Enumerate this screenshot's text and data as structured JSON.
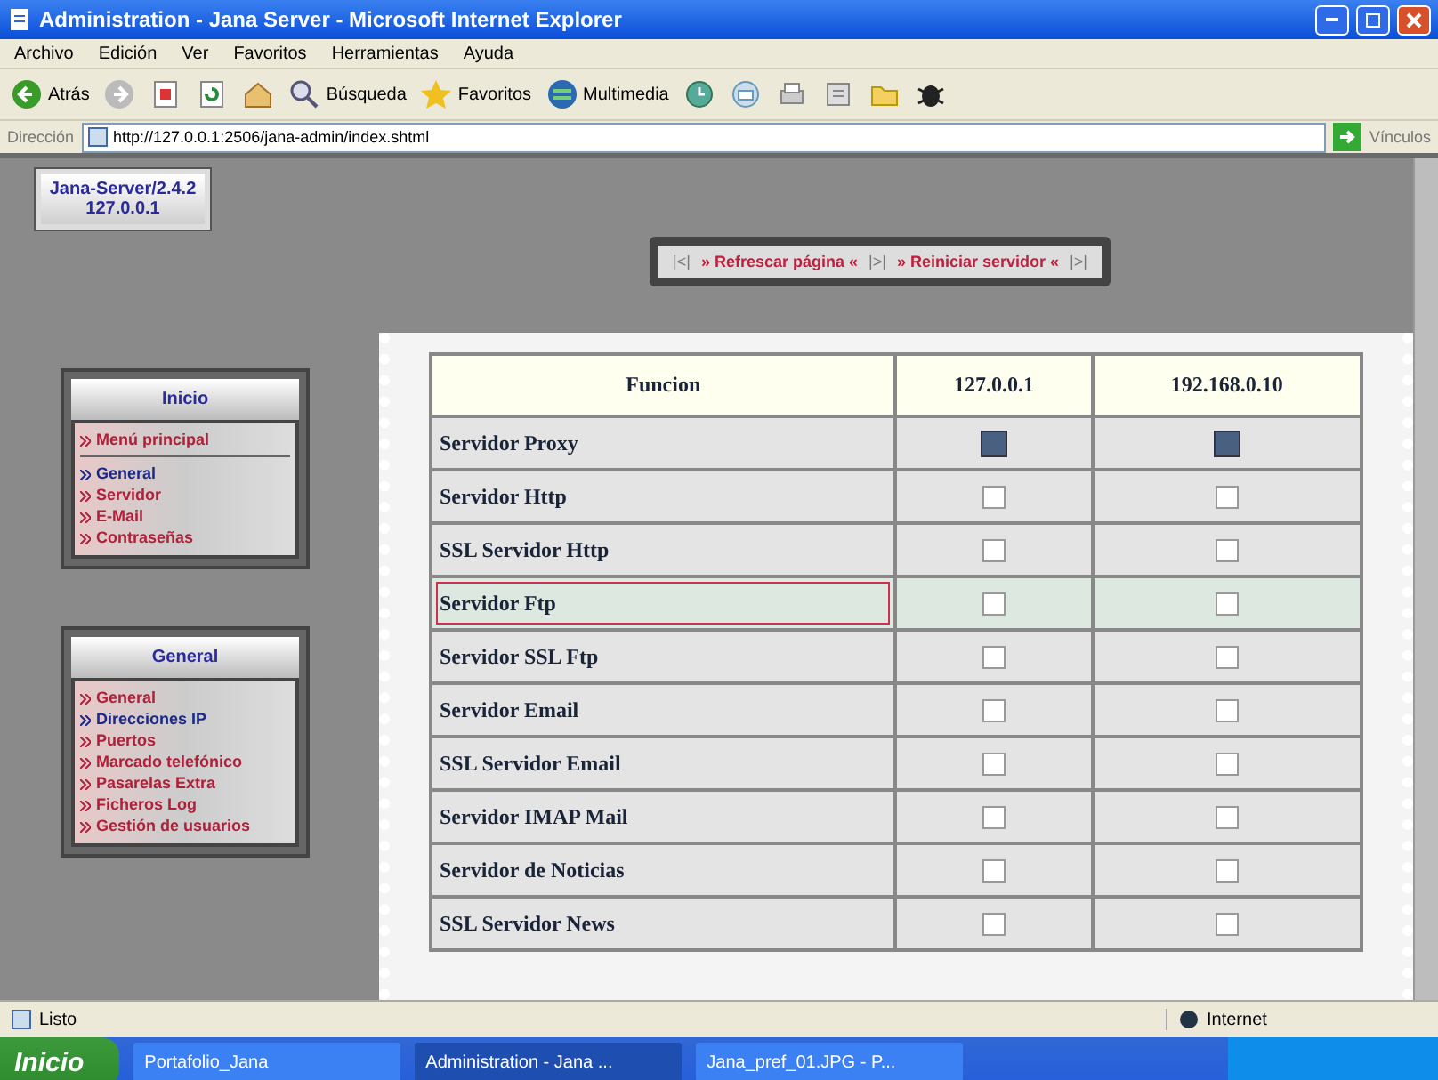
{
  "window": {
    "title": "Administration - Jana Server - Microsoft Internet Explorer"
  },
  "menu": [
    "Archivo",
    "Edición",
    "Ver",
    "Favoritos",
    "Herramientas",
    "Ayuda"
  ],
  "toolbar": [
    {
      "kind": "back",
      "label": "Atrás"
    },
    {
      "kind": "forward"
    },
    {
      "kind": "stop"
    },
    {
      "kind": "refresh"
    },
    {
      "kind": "home"
    },
    {
      "kind": "search",
      "label": "Búsqueda"
    },
    {
      "kind": "favorites",
      "label": "Favoritos"
    },
    {
      "kind": "media",
      "label": "Multimedia"
    },
    {
      "kind": "history"
    },
    {
      "kind": "mail"
    },
    {
      "kind": "print"
    },
    {
      "kind": "edit"
    },
    {
      "kind": "folder"
    },
    {
      "kind": "bug"
    }
  ],
  "address": {
    "label": "Dirección",
    "value": "http://127.0.0.1:2506/jana-admin/index.shtml",
    "links": "Vínculos"
  },
  "server_box": {
    "name": "Jana-Server/2.4.2",
    "ip": "127.0.0.1"
  },
  "top_buttons": [
    {
      "left": "|<|",
      "label": "» Refrescar página «"
    },
    {
      "left": "|>|",
      "label": "» Reiniciar servidor «",
      "right": "|>|"
    }
  ],
  "panels": [
    {
      "title": "Inicio",
      "items": [
        {
          "label": "Menú principal",
          "selected": false,
          "kind": "main"
        },
        {
          "label": "General",
          "selected": true,
          "kind": "link"
        },
        {
          "label": "Servidor",
          "selected": false,
          "kind": "link"
        },
        {
          "label": "E-Mail",
          "selected": false,
          "kind": "link"
        },
        {
          "label": "Contraseñas",
          "selected": false,
          "kind": "link"
        }
      ]
    },
    {
      "title": "General",
      "items": [
        {
          "label": "General",
          "selected": false,
          "kind": "link"
        },
        {
          "label": "Direcciones IP",
          "selected": true,
          "kind": "link"
        },
        {
          "label": "Puertos",
          "selected": false,
          "kind": "link"
        },
        {
          "label": "Marcado telefónico",
          "selected": false,
          "kind": "link"
        },
        {
          "label": "Pasarelas Extra",
          "selected": false,
          "kind": "link"
        },
        {
          "label": "Ficheros Log",
          "selected": false,
          "kind": "link"
        },
        {
          "label": "Gestión de usuarios",
          "selected": false,
          "kind": "link"
        }
      ]
    }
  ],
  "table": {
    "columns": [
      "Funcion",
      "127.0.0.1",
      "192.168.0.10"
    ],
    "rows": [
      {
        "name": "Servidor Proxy",
        "hovered": false,
        "checks": [
          true,
          true
        ]
      },
      {
        "name": "Servidor Http",
        "hovered": false,
        "checks": [
          false,
          false
        ]
      },
      {
        "name": "SSL Servidor Http",
        "hovered": false,
        "checks": [
          false,
          false
        ]
      },
      {
        "name": "Servidor Ftp",
        "hovered": true,
        "checks": [
          false,
          false
        ]
      },
      {
        "name": "Servidor SSL Ftp",
        "hovered": false,
        "checks": [
          false,
          false
        ]
      },
      {
        "name": "Servidor Email",
        "hovered": false,
        "checks": [
          false,
          false
        ]
      },
      {
        "name": "SSL Servidor Email",
        "hovered": false,
        "checks": [
          false,
          false
        ]
      },
      {
        "name": "Servidor IMAP Mail",
        "hovered": false,
        "checks": [
          false,
          false
        ]
      },
      {
        "name": "Servidor de Noticias",
        "hovered": false,
        "checks": [
          false,
          false
        ]
      },
      {
        "name": "SSL Servidor News",
        "hovered": false,
        "checks": [
          false,
          false
        ]
      }
    ]
  },
  "status_bar": {
    "text": "Listo",
    "zone": "Internet"
  },
  "taskbar": {
    "start": "Inicio",
    "tasks": [
      {
        "label": "Portafolio_Jana",
        "selected": false
      },
      {
        "label": "Administration - Jana ...",
        "selected": true
      },
      {
        "label": "Jana_pref_01.JPG - P...",
        "selected": false
      }
    ]
  }
}
